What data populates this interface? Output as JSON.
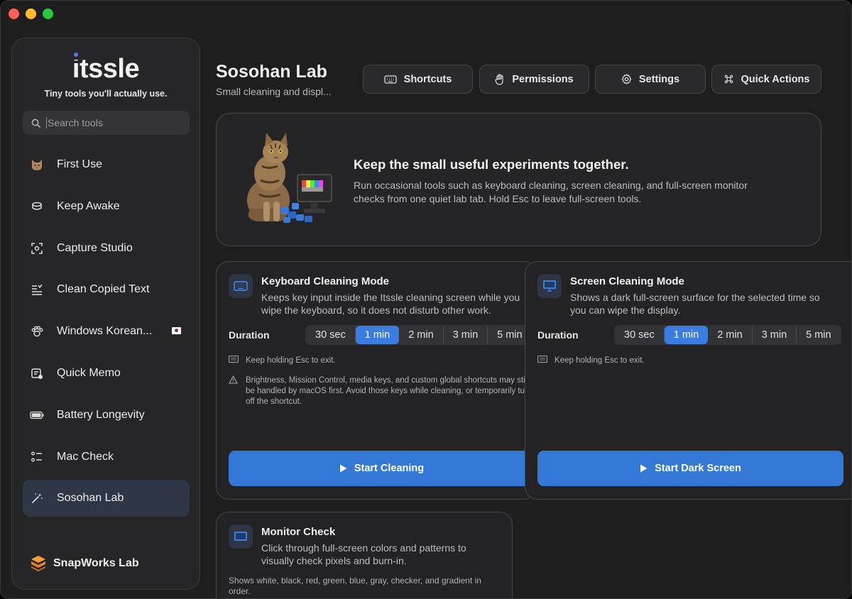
{
  "sidebar": {
    "logo": "itssle",
    "tagline": "Tiny tools you'll actually use.",
    "search_placeholder": "Search tools",
    "items": [
      {
        "label": "First Use",
        "icon": "cat-icon"
      },
      {
        "label": "Keep Awake",
        "icon": "coffee-cup-icon"
      },
      {
        "label": "Capture Studio",
        "icon": "screenshot-icon"
      },
      {
        "label": "Clean Copied Text",
        "icon": "text-clean-icon"
      },
      {
        "label": "Windows Korean...",
        "icon": "paw-icon"
      },
      {
        "label": "Quick Memo",
        "icon": "memo-icon"
      },
      {
        "label": "Battery Longevity",
        "icon": "battery-icon"
      },
      {
        "label": "Mac Check",
        "icon": "checklist-icon"
      },
      {
        "label": "Sosohan Lab",
        "icon": "magic-wand-icon",
        "active": true
      }
    ],
    "brand": "SnapWorks Lab"
  },
  "header": {
    "title": "Sosohan Lab",
    "subtitle": "Small cleaning and displ...",
    "buttons": {
      "shortcuts": "Shortcuts",
      "permissions": "Permissions",
      "settings": "Settings",
      "quick_actions": "Quick Actions"
    }
  },
  "hero": {
    "title": "Keep the small useful experiments together.",
    "text": "Run occasional tools such as keyboard cleaning, screen cleaning, and full-screen monitor checks from one quiet lab tab. Hold Esc to leave full-screen tools."
  },
  "keyboard_card": {
    "title": "Keyboard Cleaning Mode",
    "desc": "Keeps key input inside the Itssle cleaning screen while you\nwipe the keyboard, so it does not disturb other work.",
    "duration_label": "Duration",
    "durations": [
      "30 sec",
      "1 min",
      "2 min",
      "3 min",
      "5 min"
    ],
    "selected": "1 min",
    "note_esc": "Keep holding Esc to exit.",
    "note_warning": "Brightness, Mission Control, media keys, and custom global shortcuts may still be handled by macOS first. Avoid those keys while cleaning, or temporarily turn off the shortcut.",
    "button": "Start Cleaning"
  },
  "screen_card": {
    "title": "Screen Cleaning Mode",
    "desc": "Shows a dark full-screen surface for the selected time so\nyou can wipe the display.",
    "duration_label": "Duration",
    "durations": [
      "30 sec",
      "1 min",
      "2 min",
      "3 min",
      "5 min"
    ],
    "selected": "1 min",
    "note_esc": "Keep holding Esc to exit.",
    "button": "Start Dark Screen"
  },
  "monitor_card": {
    "title": "Monitor Check",
    "desc": "Click through full-screen colors and patterns to\nvisually check pixels and burn-in.",
    "note": "Shows white, black, red, green, blue, gray, checker, and gradient in order."
  },
  "colors": {
    "accent": "#3478d6",
    "window_bg": "#1e1e1f",
    "active_nav": "#2f3746"
  }
}
